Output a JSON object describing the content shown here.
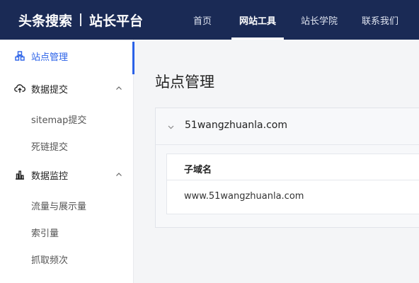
{
  "header": {
    "brand_name": "头条搜索",
    "brand_product": "站长平台",
    "nav": [
      {
        "label": "首页",
        "active": false
      },
      {
        "label": "网站工具",
        "active": true
      },
      {
        "label": "站长学院",
        "active": false
      },
      {
        "label": "联系我们",
        "active": false
      }
    ]
  },
  "sidebar": {
    "site_manage": {
      "label": "站点管理",
      "icon": "site-manage-icon",
      "active": true
    },
    "data_submit": {
      "label": "数据提交",
      "icon": "cloud-upload-icon",
      "expanded": true,
      "children": [
        "sitemap提交",
        "死链提交"
      ]
    },
    "data_monitor": {
      "label": "数据监控",
      "icon": "bar-chart-icon",
      "expanded": true,
      "children": [
        "流量与展示量",
        "索引量",
        "抓取频次"
      ]
    }
  },
  "main": {
    "title": "站点管理",
    "site": {
      "domain": "51wangzhuanla.com",
      "table_header": "子域名",
      "subdomains": [
        "www.51wangzhuanla.com"
      ]
    }
  },
  "colors": {
    "header_bg": "#1a2a55",
    "accent": "#2b62e8"
  }
}
